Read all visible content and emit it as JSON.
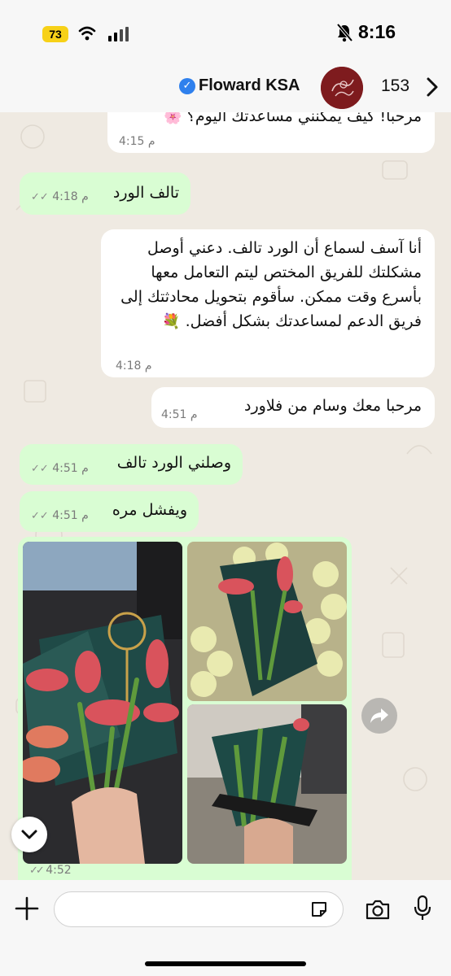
{
  "status_bar": {
    "time": "8:16",
    "battery": "73"
  },
  "header": {
    "contact_name": "Floward KSA",
    "unread_count": "153"
  },
  "messages": [
    {
      "text": "مرحبا! كيف يمكنني مساعدتك اليوم؟",
      "emoji": "🌸",
      "time": "4:15 م"
    },
    {
      "text": "تالف الورد",
      "time": "4:18 م"
    },
    {
      "text": "أنا آسف لسماع أن الورد تالف. دعني أوصل مشكلتك للفريق المختص ليتم التعامل معها بأسرع وقت ممكن. سأقوم بتحويل محادثتك إلى فريق الدعم لمساعدتك بشكل أفضل.",
      "emoji": "💐",
      "time": "4:18 م"
    },
    {
      "text": "مرحبا معك وسام من فلاورد",
      "time": "4:51 م"
    },
    {
      "text": "وصلني الورد تالف",
      "time": "4:51 م"
    },
    {
      "text": "ويفشل مره",
      "time": "4:51 م"
    }
  ],
  "photo_group": {
    "time": "4:52"
  },
  "composer": {
    "value": ""
  },
  "icons": {
    "verified": "verified-badge-icon",
    "back": "chevron-right-icon",
    "forward": "forward-icon",
    "scroll": "chevron-down-icon",
    "add": "plus-icon",
    "sticker": "sticker-icon",
    "camera": "camera-icon",
    "mic": "microphone-icon"
  },
  "colors": {
    "incoming": "#ffffff",
    "outgoing": "#d9fdd3",
    "background": "#efeae2",
    "verified": "#2f80ed"
  }
}
